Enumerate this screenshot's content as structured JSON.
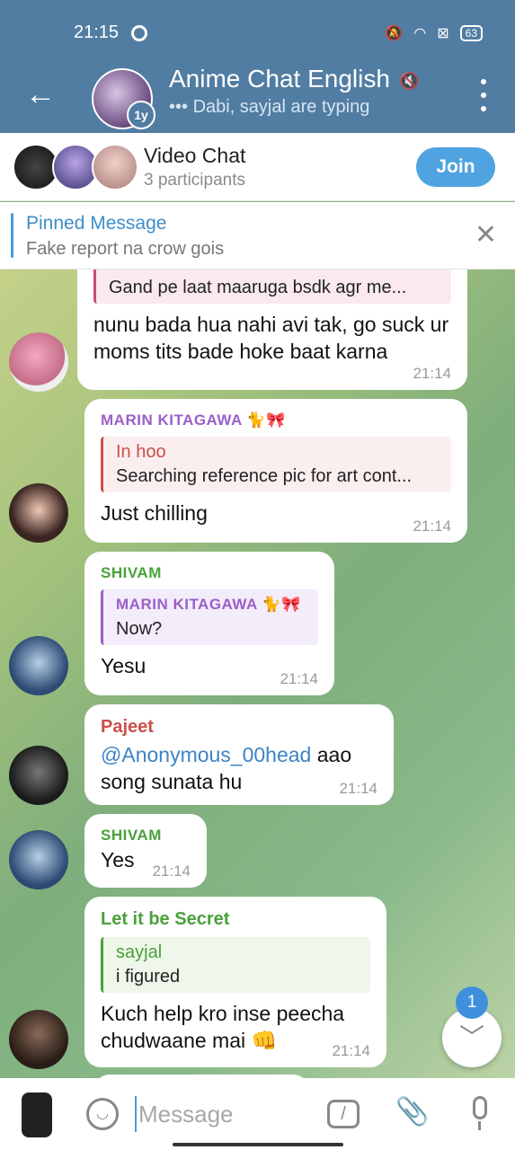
{
  "status_bar": {
    "time": "21:15",
    "battery": "63"
  },
  "header": {
    "title": "Anime Chat English",
    "subtitle": "••• Dabi, sayjal are typing",
    "avatar_badge": "1y"
  },
  "video_chat": {
    "title": "Video Chat",
    "participants": "3 participants",
    "join_label": "Join"
  },
  "pinned": {
    "title": "Pinned Message",
    "text": "Fake report na crow gois"
  },
  "messages": [
    {
      "reply_text": "Gand pe laat maaruga bsdk agr me...",
      "body": "nunu bada hua nahi avi tak, go suck ur moms tits bade hoke baat karna",
      "time": "21:14"
    },
    {
      "sender": "MARIN KITAGAWA 🐈🎀",
      "reply_name": "In hoo",
      "reply_text": "Searching reference pic for art cont...",
      "body": "Just chilling",
      "time": "21:14"
    },
    {
      "sender": "SHIVAM",
      "reply_name": "MARIN KITAGAWA 🐈🎀",
      "reply_text": "Now?",
      "body": "Yesu",
      "time": "21:14"
    },
    {
      "sender": "Pajeet",
      "mention": "@Anonymous_00head",
      "body": " aao song sunata hu",
      "time": "21:14"
    },
    {
      "sender": "SHIVAM",
      "body": "Yes",
      "time": "21:14"
    },
    {
      "sender": "Let it be Secret",
      "reply_name": "sayjal",
      "reply_text": "i figured",
      "body": "Kuch help kro inse peecha chudwaane mai 👊",
      "time": "21:14"
    }
  ],
  "scroll_badge": "1",
  "input": {
    "placeholder": "Message",
    "cmd_label": "/"
  },
  "colors": {
    "header": "#517da2",
    "join": "#4fa3e0",
    "marin": "#9a5fc9",
    "shivam": "#4aa13a",
    "pajeet": "#c9504a",
    "secret": "#4aa13a",
    "inhoo": "#c9504a",
    "pink_reply": "#d1467e"
  }
}
